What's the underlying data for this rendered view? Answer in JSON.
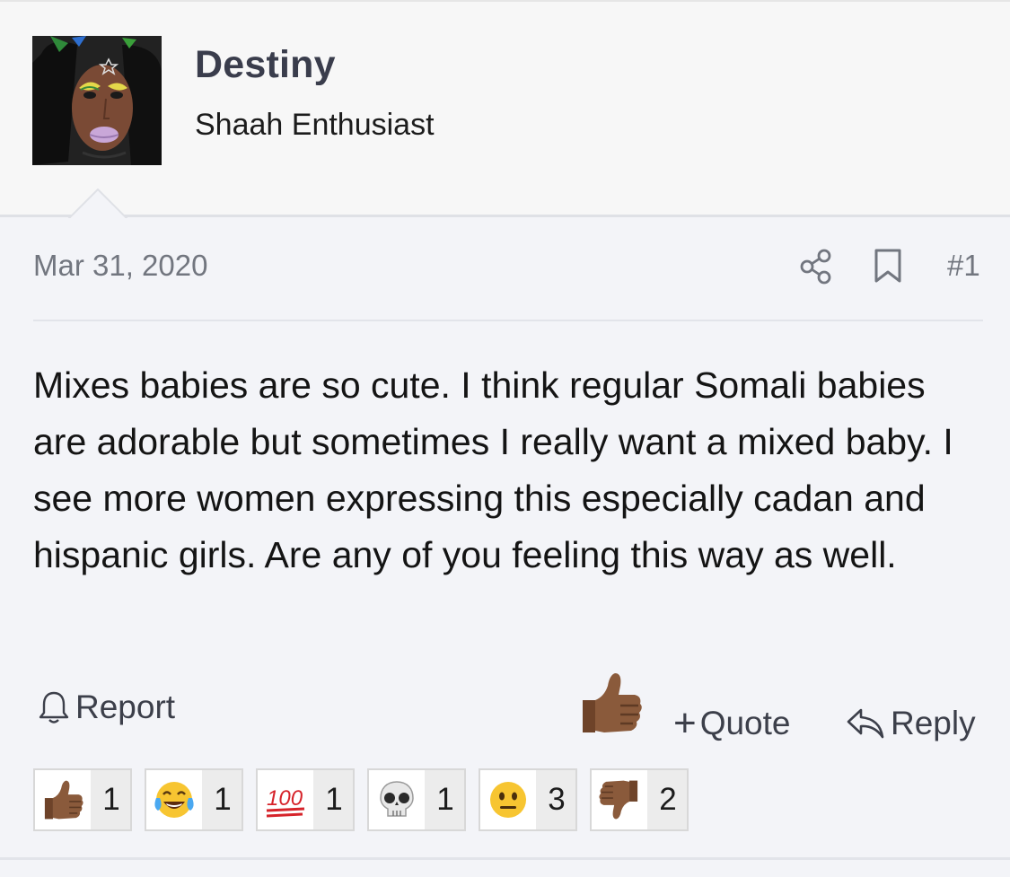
{
  "user": {
    "name": "Destiny",
    "title": "Shaah Enthusiast",
    "avatar_icon": "user-avatar-photo"
  },
  "post": {
    "date": "Mar 31, 2020",
    "number": "#1",
    "body": "Mixes babies are so cute. I think regular Somali babies are adorable but sometimes I really want a mixed baby. I see more women expressing this especially cadan and hispanic girls. Are any of you feeling this way as well."
  },
  "actions": {
    "report_label": "Report",
    "quote_label": "Quote",
    "quote_prefix": "+",
    "reply_label": "Reply",
    "like_icon": "thumbs-up-emoji"
  },
  "reactions": [
    {
      "icon": "thumbs-up-emoji",
      "count": "1"
    },
    {
      "icon": "tears-of-joy-emoji",
      "count": "1"
    },
    {
      "icon": "hundred-points-emoji",
      "count": "1"
    },
    {
      "icon": "skull-emoji",
      "count": "1"
    },
    {
      "icon": "neutral-face-emoji",
      "count": "3"
    },
    {
      "icon": "thumbs-down-emoji",
      "count": "2"
    }
  ],
  "colors": {
    "background": "#f3f4f8",
    "header_background": "#f7f7f7",
    "username": "#3a3d4c",
    "muted_text": "#72767f",
    "skin_tone": "#8a5a3b"
  }
}
